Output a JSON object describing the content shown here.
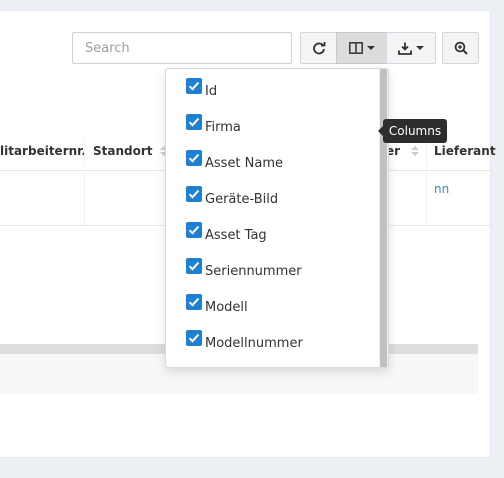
{
  "toolbar": {
    "search_placeholder": "Search",
    "refresh_icon": "refresh-icon",
    "columns_icon": "columns-icon",
    "export_icon": "download-icon",
    "zoom_icon": "zoom-in-icon"
  },
  "table": {
    "headers": [
      "litarbeiternr.",
      "Standort",
      "er",
      "Lieferant"
    ],
    "row_link_text": "nn"
  },
  "columns_dropdown": {
    "items": [
      {
        "label": "Id",
        "checked": true
      },
      {
        "label": "Firma",
        "checked": true
      },
      {
        "label": "Asset Name",
        "checked": true
      },
      {
        "label": "Geräte-Bild",
        "checked": true
      },
      {
        "label": "Asset Tag",
        "checked": true
      },
      {
        "label": "Seriennummer",
        "checked": true
      },
      {
        "label": "Modell",
        "checked": true
      },
      {
        "label": "Modellnummer",
        "checked": true
      }
    ]
  },
  "tooltip": {
    "text": "Columns"
  },
  "colors": {
    "accent": "#1f7fd1",
    "link": "#3c8dbc",
    "tooltip_bg": "#2d2d2d",
    "page_bg": "#ecf0f5"
  }
}
